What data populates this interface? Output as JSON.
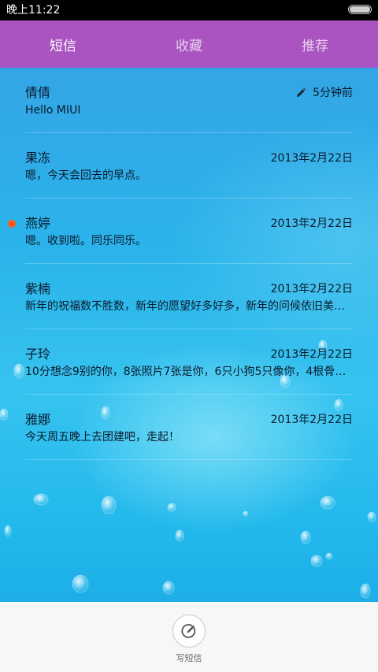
{
  "status_bar": {
    "time": "晚上11:22"
  },
  "tabs": [
    {
      "label": "短信",
      "active": true
    },
    {
      "label": "收藏",
      "active": false
    },
    {
      "label": "推荐",
      "active": false
    }
  ],
  "messages": [
    {
      "name": "倩倩",
      "time": "5分钟前",
      "preview": "Hello MIUI",
      "draft_icon": "pencil-icon",
      "unread": false
    },
    {
      "name": "果冻",
      "time": "2013年2月22日",
      "preview": "嗯，今天会回去的早点。",
      "unread": false
    },
    {
      "name": "燕婷",
      "time": "2013年2月22日",
      "preview": "嗯。收到啦。同乐同乐。",
      "unread": true
    },
    {
      "name": "紫楠",
      "time": "2013年2月22日",
      "preview": "新年的祝福数不胜数，新年的愿望好多好多，新年的问候依旧美好…",
      "unread": false
    },
    {
      "name": "子玲",
      "time": "2013年2月22日",
      "preview": "10分想念9别的你，8张照片7张是你，6只小狗5只像你，4根骨头…",
      "unread": false
    },
    {
      "name": "雅娜",
      "time": "2013年2月22日",
      "preview": "今天周五晚上去团建吧，走起！",
      "unread": false
    }
  ],
  "compose": {
    "label": "写短信",
    "icon": "compose-icon"
  },
  "colors": {
    "tab_bar": "#a954c0",
    "unread_dot": "#ff5a1a",
    "background": "#2a9fe0"
  }
}
